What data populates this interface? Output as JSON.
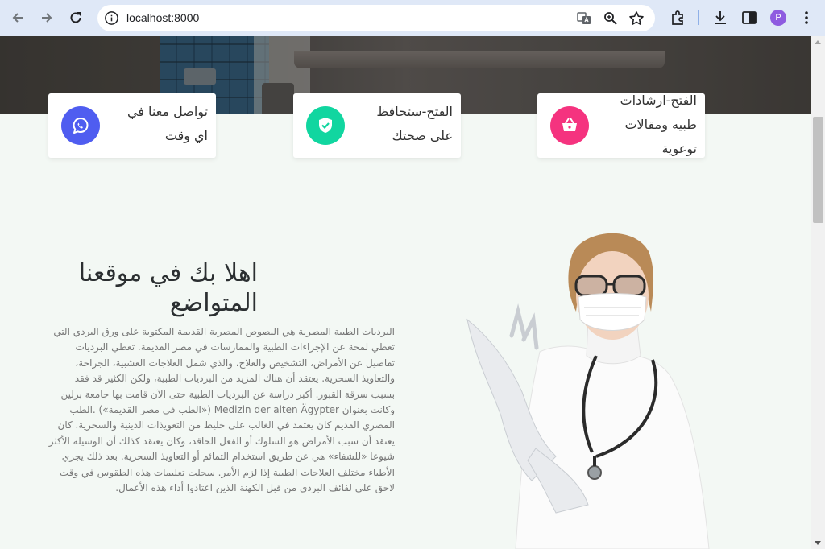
{
  "browser": {
    "url": "localhost:8000",
    "profile_initial": "P"
  },
  "features": [
    {
      "text": "تواصل معنا في اي وقت",
      "icon": "chat-icon",
      "color": "#4f5df0"
    },
    {
      "text": "الفتح-ستحافظ على صحتك",
      "icon": "shield-check-icon",
      "color": "#11d6a0"
    },
    {
      "text": "الفتح-ارشادات طبيه ومقالات توعوية",
      "icon": "basket-icon",
      "color": "#f5337f"
    }
  ],
  "welcome": {
    "title": "اهلا بك في موقعنا المتواضع",
    "body": "البرديات الطبية المصرية هي النصوص المصرية القديمة المكتوبة على ورق البردي التي تعطي لمحة عن الإجراءات الطبية والممارسات في مصر القديمة. تعطي البرديات تفاصيل عن الأمراض، التشخيص والعلاج، والذي شمل العلاجات العشبية، الجراحة، والتعاويذ السحرية. يعتقد أن هناك المزيد من البرديات الطبية، ولكن الكثير قد فقد بسبب سرقة القبور. أكبر دراسة عن البرديات الطبية حتى الآن قامت بها جامعة برلين وكانت بعنوان Medizin der alten Ägypter («الطب في مصر القديمة») .الطب المصري القديم كان يعتمد في الغالب على خليط من التعويذات الدينية والسحرية. كان يعتقد أن سبب الأمراض هو السلوك أو الفعل الحاقد، وكان يعتقد كذلك أن الوسيلة الأكثر شيوعا «للشفاء» هي عن طريق استخدام التمائم أو التعاويذ السحرية. بعد ذلك يجري الأطباء مختلف العلاجات الطبية إذا لزم الأمر. سجلت تعليمات هذه الطقوس في وقت لاحق على لفائف البردي من قبل الكهنة الذين اعتادوا أداء هذه الأعمال."
  }
}
